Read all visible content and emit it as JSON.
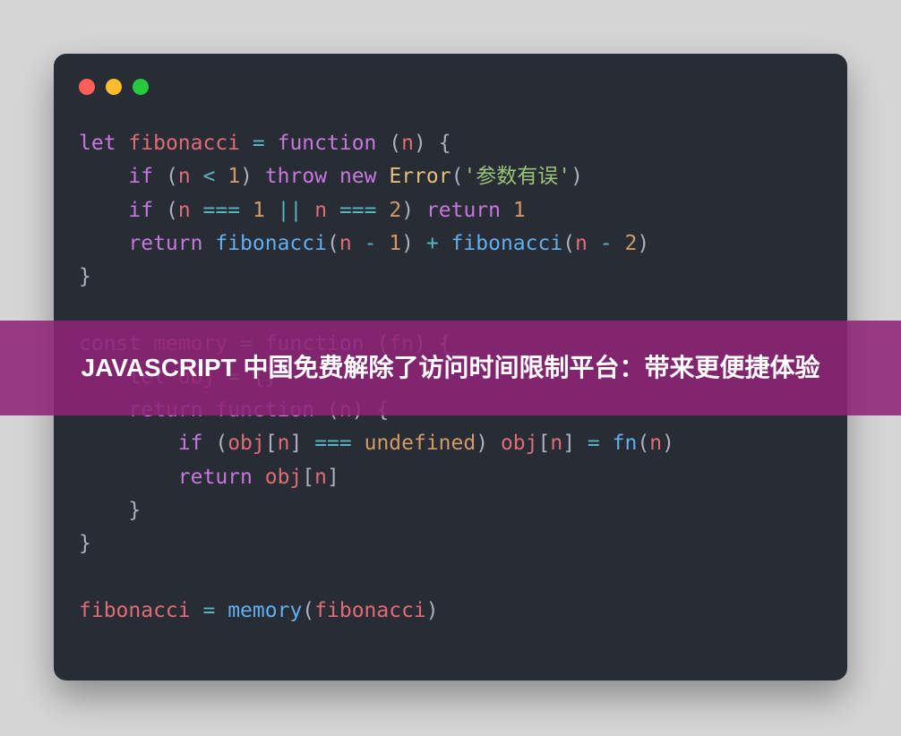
{
  "overlay": {
    "text": "JAVASCRIPT 中国免费解除了访问时间限制平台：带来更便捷体验"
  },
  "code": {
    "kw_let": "let",
    "id_fib": "fibonacci",
    "op_assign": "=",
    "kw_function": "function",
    "param_n": "n",
    "kw_if": "if",
    "op_lt": "<",
    "num_1": "1",
    "kw_throw": "throw",
    "kw_new": "new",
    "cls_error": "Error",
    "str_err": "'参数有误'",
    "op_eq3": "===",
    "op_or": "||",
    "num_2": "2",
    "kw_return": "return",
    "op_minus": "-",
    "op_plus": "+",
    "kw_const": "const",
    "id_memory": "memory",
    "param_fn": "fn",
    "id_obj": "obj",
    "empty_obj_open": "{",
    "empty_obj_close": "}",
    "id_undefined": "undefined",
    "call_fn": "fn",
    "line1_open": "(",
    "line1_close": ")",
    "brace_open": "{",
    "brace_close": "}",
    "bracket_open": "[",
    "bracket_close": "]"
  }
}
